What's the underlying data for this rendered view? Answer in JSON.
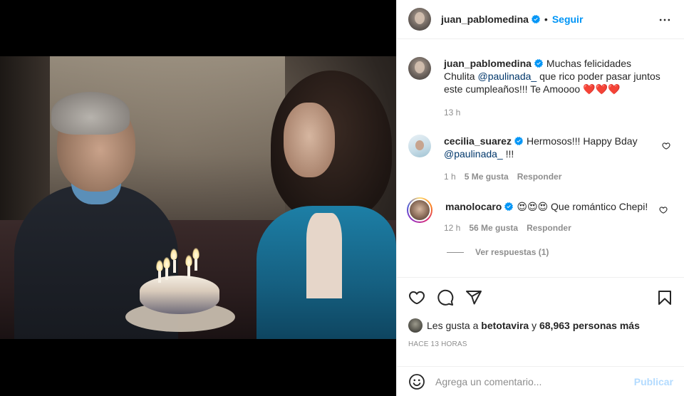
{
  "post": {
    "author": "juan_pablomedina",
    "follow_label": "Seguir",
    "dot": "•",
    "caption": {
      "username": "juan_pablomedina",
      "text_before": "Muchas felicidades Chulita",
      "mention": "@paulinada_",
      "text_after": " que rico poder pasar juntos este cumpleaños!!! Te Amoooo ❤️❤️❤️",
      "age": "13 h"
    },
    "comments": [
      {
        "username": "cecilia_suarez",
        "text_before": "Hermosos!!! Happy Bday",
        "mention": "@paulinada_",
        "text_after": " !!!",
        "age": "1 h",
        "likes": "5 Me gusta",
        "reply_label": "Responder"
      },
      {
        "username": "manolocaro",
        "text": "😍😍😍 Que romántico Chepi!",
        "age": "12 h",
        "likes": "56 Me gusta",
        "reply_label": "Responder",
        "view_replies": "Ver respuestas (1)"
      }
    ],
    "likes_line": {
      "prefix": "Les gusta a",
      "user": "betotavira",
      "conj": "y",
      "others": "68,963 personas más"
    },
    "timestamp": "HACE 13 HORAS",
    "add_comment": {
      "placeholder": "Agrega un comentario...",
      "publish_label": "Publicar"
    }
  },
  "colors": {
    "accent": "#0095f6",
    "verified": "#0095f6",
    "publish_disabled": "#b3dbff",
    "muted": "#8e8e8e",
    "mention": "#00376b"
  },
  "icons": [
    "verified-badge-icon",
    "more-options-icon",
    "heart-icon",
    "comment-icon",
    "share-icon",
    "bookmark-icon",
    "emoji-icon"
  ]
}
